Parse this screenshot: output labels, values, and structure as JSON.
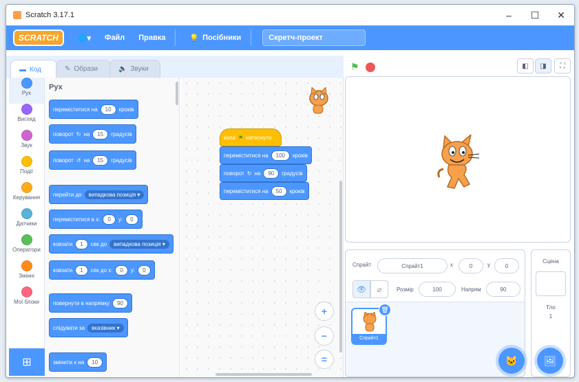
{
  "window": {
    "title": "Scratch 3.17.1",
    "minimize": "–",
    "maximize": "☐",
    "close": "✕"
  },
  "menu": {
    "logo": "SCRATCH",
    "globe": "🌐▾",
    "file": "Файл",
    "edit": "Правка",
    "tutorials": "Посібники",
    "project_title": "Скретч-проект"
  },
  "tabs": {
    "code": "Код",
    "costumes": "Образи",
    "sounds": "Звуки"
  },
  "categories": [
    {
      "label": "Рух",
      "color": "#4c97ff"
    },
    {
      "label": "Вигляд",
      "color": "#9966ff"
    },
    {
      "label": "Звук",
      "color": "#cf63cf"
    },
    {
      "label": "Події",
      "color": "#ffbf00"
    },
    {
      "label": "Керування",
      "color": "#ffab19"
    },
    {
      "label": "Датчики",
      "color": "#5cb1d6"
    },
    {
      "label": "Оператори",
      "color": "#59c059"
    },
    {
      "label": "Змінні",
      "color": "#ff8c1a"
    },
    {
      "label": "Мої блоки",
      "color": "#ff6680"
    }
  ],
  "palette": {
    "section_title": "Рух",
    "move": {
      "a": "переміститися на",
      "val": "10",
      "b": "кроків"
    },
    "turn_right": {
      "a": "поворот",
      "b": "на",
      "val": "15",
      "c": "градусів"
    },
    "turn_left": {
      "a": "поворот",
      "b": "на",
      "val": "15",
      "c": "градусів"
    },
    "goto": {
      "a": "перейти до",
      "drop": "випадкова позиція ▾"
    },
    "goto_xy": {
      "a": "переміститися в x:",
      "x": "0",
      "b": "y:",
      "y": "0"
    },
    "glide": {
      "a": "ковзати",
      "val": "1",
      "b": "сек до",
      "drop": "випадкова позиція ▾"
    },
    "glide_xy": {
      "a": "ковзати",
      "val": "1",
      "b": "сек до x:",
      "x": "0",
      "c": "y:",
      "y": "0"
    },
    "point_dir": {
      "a": "повернути в напрямку",
      "val": "90"
    },
    "point_towards": {
      "a": "слідувати за",
      "drop": "вказівник ▾"
    },
    "change_x": {
      "a": "змінити х на",
      "val": "10"
    }
  },
  "script": {
    "hat": {
      "a": "коли",
      "b": "натиснуто"
    },
    "move": {
      "a": "переміститися на",
      "val": "100",
      "b": "кроків"
    },
    "turn": {
      "a": "поворот",
      "b": "на",
      "val": "90",
      "c": "градусів"
    },
    "move2": {
      "a": "переміститися на",
      "val": "50",
      "b": "кроків"
    }
  },
  "zoom": {
    "in": "+",
    "out": "−",
    "reset": "="
  },
  "sprite_info": {
    "sprite_label": "Спрайт",
    "sprite_name": "Спрайт1",
    "x_label": "x",
    "x": "0",
    "y_label": "y",
    "y": "0",
    "size_label": "Розмір",
    "size": "100",
    "dir_label": "Напрям",
    "dir": "90",
    "thumb_name": "Спрайт1"
  },
  "stage_pane": {
    "title": "Сцена",
    "backdrop_label": "Тло",
    "backdrop_count": "1"
  },
  "colors": {
    "motion": "#4c97ff",
    "events": "#ffbf00",
    "brand": "#4c97ff"
  }
}
